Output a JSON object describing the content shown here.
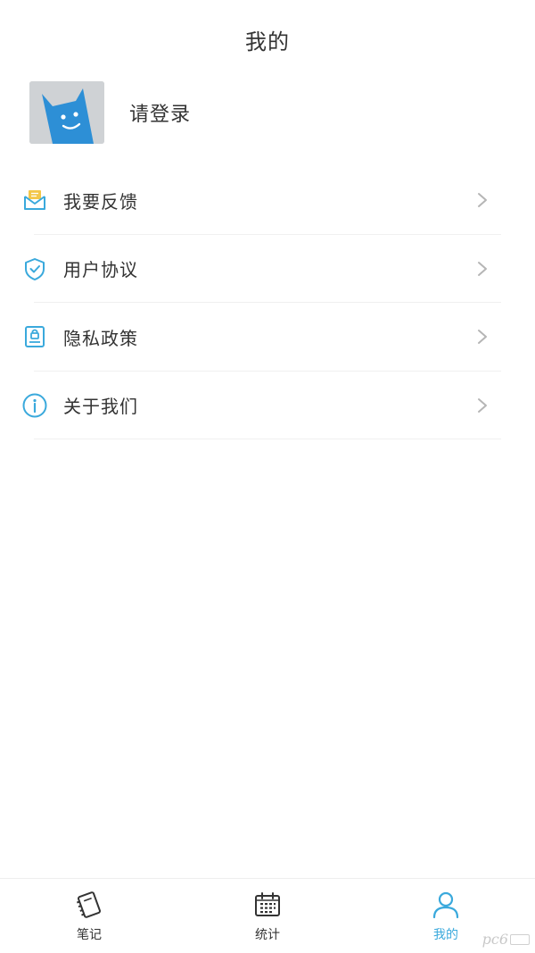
{
  "header": {
    "title": "我的"
  },
  "profile": {
    "login_label": "请登录",
    "avatar_icon": "cat-avatar"
  },
  "menu": {
    "items": [
      {
        "label": "我要反馈",
        "icon": "mail-feedback-icon"
      },
      {
        "label": "用户协议",
        "icon": "shield-check-icon"
      },
      {
        "label": "隐私政策",
        "icon": "lock-document-icon"
      },
      {
        "label": "关于我们",
        "icon": "info-icon"
      }
    ]
  },
  "tabbar": {
    "tabs": [
      {
        "label": "笔记",
        "icon": "notebook-icon",
        "active": false
      },
      {
        "label": "统计",
        "icon": "calendar-icon",
        "active": false
      },
      {
        "label": "我的",
        "icon": "user-icon",
        "active": true
      }
    ]
  },
  "watermark": {
    "text": "pc6"
  },
  "colors": {
    "accent": "#3aa9dc",
    "text": "#333333",
    "chevron": "#b5b5b5",
    "divider": "#f0f0f0"
  }
}
